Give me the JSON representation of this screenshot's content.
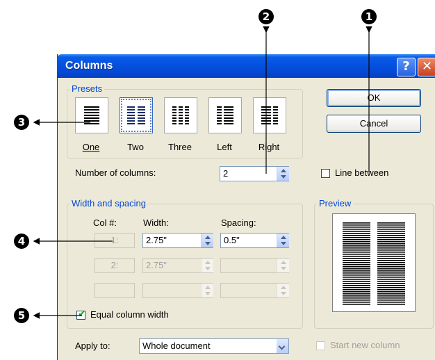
{
  "dialog": {
    "title": "Columns",
    "help_label": "?",
    "close_label": "✕"
  },
  "presets": {
    "group_label": "Presets",
    "items": [
      {
        "label": "One",
        "icon": "one-column-icon",
        "selected": false
      },
      {
        "label": "Two",
        "icon": "two-columns-icon",
        "selected": true
      },
      {
        "label": "Three",
        "icon": "three-columns-icon",
        "selected": false
      },
      {
        "label": "Left",
        "icon": "left-column-icon",
        "selected": false
      },
      {
        "label": "Right",
        "icon": "right-column-icon",
        "selected": false
      }
    ]
  },
  "buttons": {
    "ok": "OK",
    "cancel": "Cancel"
  },
  "number_of_columns": {
    "label": "Number of columns:",
    "value": "2"
  },
  "line_between": {
    "label": "Line between",
    "checked": false
  },
  "width_spacing": {
    "group_label": "Width and spacing",
    "headers": {
      "col": "Col #:",
      "width": "Width:",
      "spacing": "Spacing:"
    },
    "rows": [
      {
        "col": "1:",
        "width": "2.75\"",
        "spacing": "0.5\"",
        "enabled": true
      },
      {
        "col": "2:",
        "width": "2.75\"",
        "spacing": "",
        "enabled": false
      },
      {
        "col": "",
        "width": "",
        "spacing": "",
        "enabled": false
      }
    ]
  },
  "equal_column_width": {
    "label": "Equal column width",
    "checked": true
  },
  "preview": {
    "group_label": "Preview"
  },
  "apply_to": {
    "label": "Apply to:",
    "value": "Whole document"
  },
  "start_new_column": {
    "label": "Start new column",
    "checked": false,
    "enabled": false
  },
  "callouts": [
    "❶",
    "❷",
    "❸",
    "❹",
    "❺"
  ],
  "colors": {
    "title_bar": "#0551e0",
    "dialog_bg": "#ece9d8",
    "group_label": "#0046d5",
    "check": "#21a121"
  }
}
